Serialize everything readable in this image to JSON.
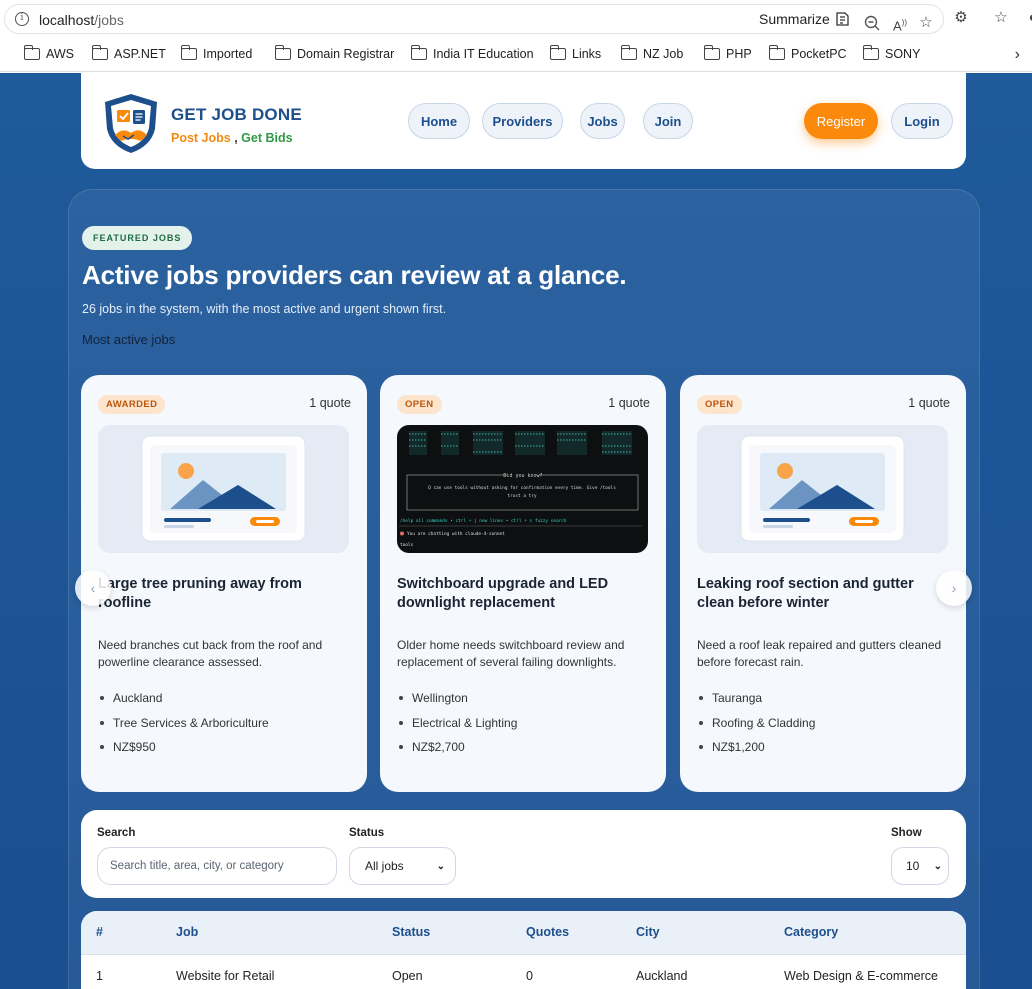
{
  "browser": {
    "url_host": "localhost",
    "url_path": "/jobs",
    "summarize_label": "Summarize",
    "bookmarks": [
      "AWS",
      "ASP.NET",
      "Imported",
      "Domain Registrar",
      "India IT Education",
      "Links",
      "NZ Job",
      "PHP",
      "PocketPC",
      "SONY"
    ]
  },
  "header": {
    "brand_name": "GET JOB DONE",
    "tagline_part1": "Post Jobs",
    "tagline_sep": " , ",
    "tagline_part2": "Get Bids",
    "nav": [
      "Home",
      "Providers",
      "Jobs",
      "Join"
    ],
    "register_label": "Register",
    "login_label": "Login",
    "colors": {
      "primary": "#1d4f8c",
      "accent": "#fb8a0c",
      "green": "#2e9a45"
    }
  },
  "featured": {
    "badge": "FEATURED JOBS",
    "headline": "Active jobs providers can review at a glance.",
    "subhead": "26 jobs in the system, with the most active and urgent shown first.",
    "section_label": "Most active jobs",
    "cards": [
      {
        "status": "AWARDED",
        "quotes": "1 quote",
        "image": "placeholder",
        "title": "Large tree pruning away from roofline",
        "description": "Need branches cut back from the roof and powerline clearance assessed.",
        "meta": [
          "Auckland",
          "Tree Services & Arboriculture",
          "NZ$950"
        ]
      },
      {
        "status": "OPEN",
        "quotes": "1 quote",
        "image": "terminal-screenshot",
        "title": "Switchboard upgrade and LED downlight replacement",
        "description": "Older home needs switchboard review and replacement of several failing downlights.",
        "meta": [
          "Wellington",
          "Electrical & Lighting",
          "NZ$2,700"
        ]
      },
      {
        "status": "OPEN",
        "quotes": "1 quote",
        "image": "placeholder",
        "title": "Leaking roof section and gutter clean before winter",
        "description": "Need a roof leak repaired and gutters cleaned before forecast rain.",
        "meta": [
          "Tauranga",
          "Roofing & Cladding",
          "NZ$1,200"
        ]
      }
    ],
    "terminal": {
      "notice_title": "Did you know?",
      "notice_line1": "Q can use tools without asking for confirmation every time. Give /tools",
      "notice_line2": "trust a try",
      "hints": "/help all commands  •  ctrl + j new lines  •  ctrl + s fuzzy search",
      "chat_line": "You are chatting with claude-4-sonnet",
      "prompt": "tools"
    }
  },
  "filters": {
    "search_label": "Search",
    "search_placeholder": "Search title, area, city, or category",
    "status_label": "Status",
    "status_value": "All jobs",
    "show_label": "Show",
    "show_value": "10"
  },
  "table": {
    "columns": [
      "#",
      "Job",
      "Status",
      "Quotes",
      "City",
      "Category"
    ],
    "rows": [
      [
        "1",
        "Website for Retail",
        "Open",
        "0",
        "Auckland",
        "Web Design & E-commerce"
      ]
    ]
  }
}
